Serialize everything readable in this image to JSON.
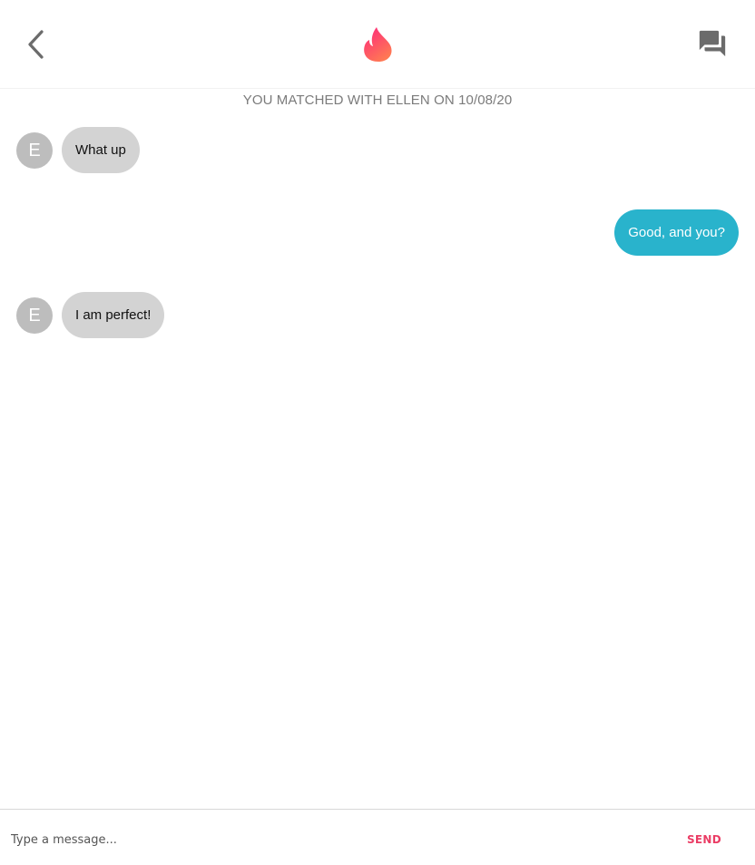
{
  "header": {
    "back_icon": "chevron-left-icon",
    "logo_icon": "flame-logo-icon",
    "matches_icon": "chat-bubbles-icon"
  },
  "match_banner": "YOU MATCHED WITH ELLEN ON 10/08/20",
  "messages": [
    {
      "from": "them",
      "avatar": "E",
      "text": "What up"
    },
    {
      "from": "me",
      "text": "Good, and you?"
    },
    {
      "from": "them",
      "avatar": "E",
      "text": "I am perfect!"
    }
  ],
  "composer": {
    "placeholder": "Type a message...",
    "value": "",
    "send_label": "SEND"
  },
  "colors": {
    "brand_start": "#fd267d",
    "brand_end": "#ff7854",
    "send": "#ea3c64",
    "outgoing_bubble": "#29b3cc",
    "incoming_bubble": "#d3d3d3",
    "avatar": "#bdbdbd",
    "icon": "#6b6b6b"
  }
}
